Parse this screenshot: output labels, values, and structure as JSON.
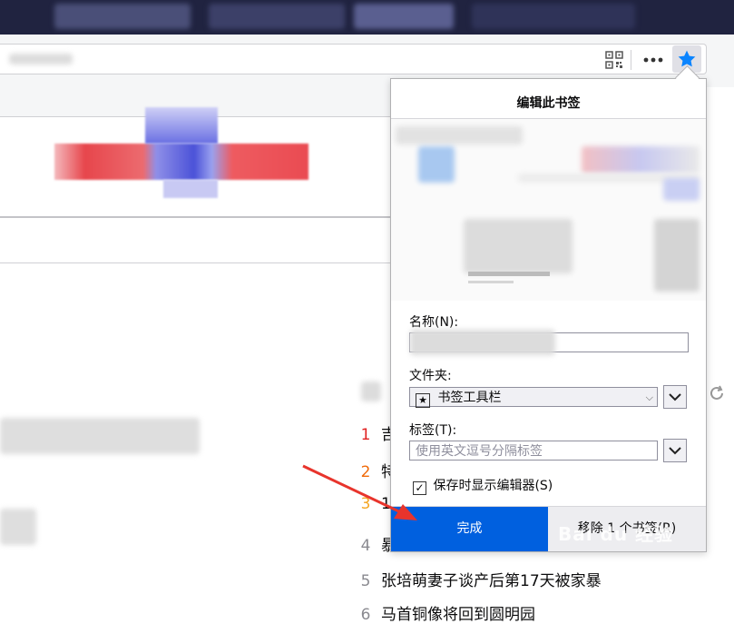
{
  "panel": {
    "title": "编辑此书签",
    "name_label": "名称(N):",
    "name_value": "",
    "folder_label": "文件夹:",
    "folder_value": "书签工具栏",
    "tags_label": "标签(T):",
    "tags_placeholder": "使用英文逗号分隔标签",
    "show_editor_label": "保存时显示编辑器(S)",
    "show_editor_checked": true,
    "done_button": "完成",
    "remove_button": "移除 1 个书签(R)"
  },
  "news": [
    {
      "num": "1",
      "color": "#e02020",
      "text": "吉"
    },
    {
      "num": "2",
      "color": "#f06a0a",
      "text": "特"
    },
    {
      "num": "3",
      "color": "#f5a623",
      "text": "1"
    },
    {
      "num": "4",
      "color": "#8a8a90",
      "text": "暴"
    },
    {
      "num": "5",
      "color": "#8a8a90",
      "text": "张培萌妻子谈产后第17天被家暴"
    },
    {
      "num": "6",
      "color": "#8a8a90",
      "text": "马首铜像将回到圆明园"
    }
  ],
  "colors": {
    "accent_blue": "#0060df",
    "tab_bar": "#202340",
    "star": "#0a84ff"
  },
  "icons": [
    "qr-code-icon",
    "more-icon",
    "bookmark-star-icon",
    "refresh-icon",
    "chevron-down-icon",
    "folder-star-icon",
    "red-arrow"
  ]
}
